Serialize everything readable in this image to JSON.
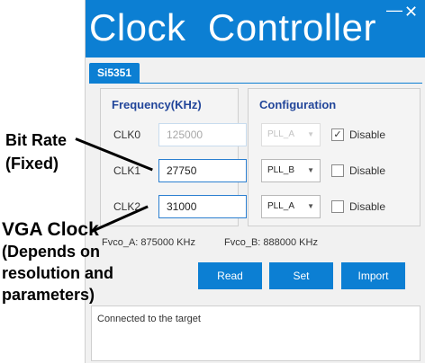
{
  "window": {
    "title": "Clock  Controller",
    "minimize_glyph": "—",
    "close_glyph": "✕",
    "tab": "Si5351"
  },
  "frequency": {
    "title": "Frequency(KHz)",
    "rows": [
      {
        "label": "CLK0",
        "value": "125000",
        "enabled": false
      },
      {
        "label": "CLK1",
        "value": "27750",
        "enabled": true
      },
      {
        "label": "CLK2",
        "value": "31000",
        "enabled": true
      }
    ]
  },
  "configuration": {
    "title": "Configuration",
    "rows": [
      {
        "pll": "PLL_A",
        "enabled": false,
        "checked": true,
        "label": "Disable"
      },
      {
        "pll": "PLL_B",
        "enabled": true,
        "checked": false,
        "label": "Disable"
      },
      {
        "pll": "PLL_A",
        "enabled": true,
        "checked": false,
        "label": "Disable"
      }
    ]
  },
  "fvco": {
    "a": "Fvco_A:  875000 KHz",
    "b": "Fvco_B:  888000 KHz"
  },
  "buttons": {
    "read": "Read",
    "set": "Set",
    "import": "Import"
  },
  "status": "Connected to the target",
  "annotations": {
    "bit_rate_line1": "Bit Rate",
    "bit_rate_line2": "(Fixed)",
    "vga_line1": "VGA Clock",
    "vga_line2": "(Depends on",
    "vga_line3": "resolution and",
    "vga_line4": "parameters)"
  },
  "colors": {
    "accent": "#0c7fd3",
    "group_title": "#22469a"
  },
  "icons": {
    "dropdown": "chevron-down-icon",
    "check": "checkmark-icon"
  }
}
